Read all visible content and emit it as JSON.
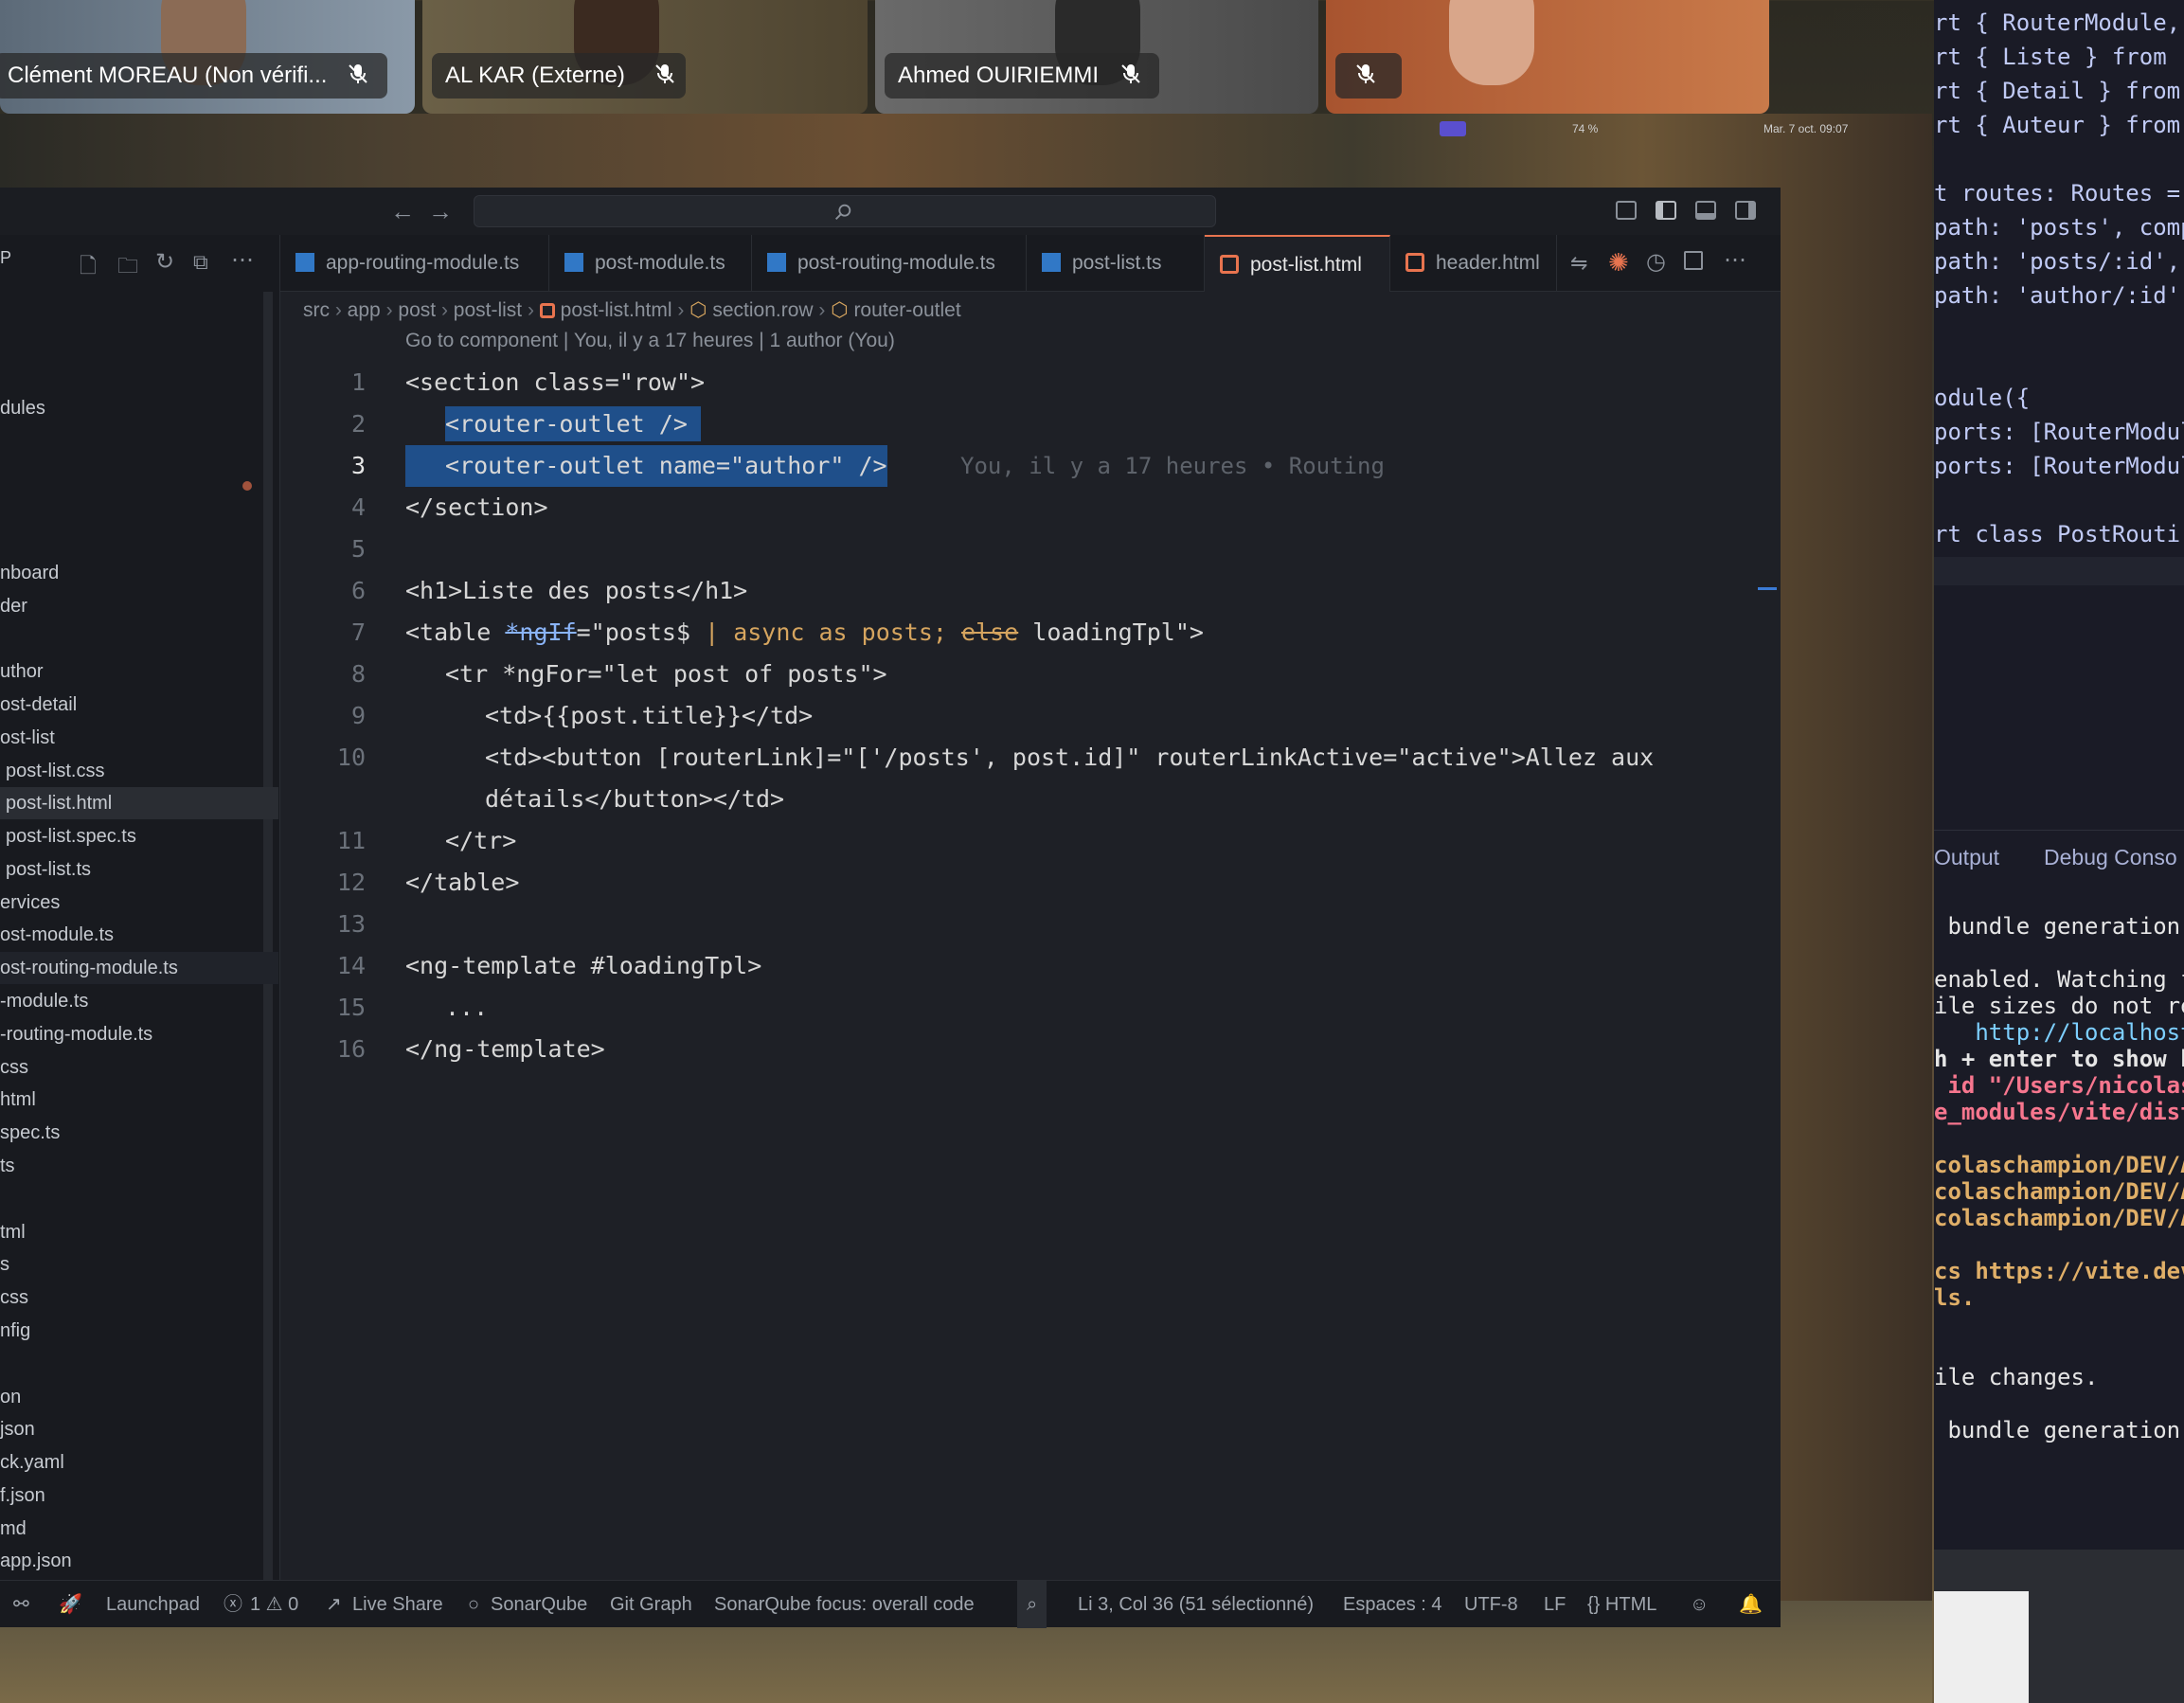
{
  "meeting": {
    "participants": [
      {
        "name": "Clément MOREAU (Non vérifi...",
        "muted": true
      },
      {
        "name": "AL KAR (Externe)",
        "muted": true
      },
      {
        "name": "Ahmed OUIRIEMMI",
        "muted": true
      },
      {
        "name": "",
        "muted": true
      }
    ]
  },
  "menubar": {
    "battery": "74 %",
    "datetime": "Mar. 7 oct. 09:07"
  },
  "sidebar": {
    "header": "P",
    "items": [
      {
        "label": "dules",
        "top": 0
      },
      {
        "label": "nboard"
      },
      {
        "label": "der"
      },
      {
        "label": "uthor"
      },
      {
        "label": "ost-detail"
      },
      {
        "label": "ost-list"
      },
      {
        "label": "post-list.css"
      },
      {
        "label": "post-list.html"
      },
      {
        "label": "post-list.spec.ts"
      },
      {
        "label": "post-list.ts"
      },
      {
        "label": "ervices"
      },
      {
        "label": "ost-module.ts"
      },
      {
        "label": "ost-routing-module.ts"
      },
      {
        "label": "-module.ts"
      },
      {
        "label": "-routing-module.ts"
      },
      {
        "label": "css"
      },
      {
        "label": "html"
      },
      {
        "label": "spec.ts"
      },
      {
        "label": "ts"
      },
      {
        "label": "tml"
      },
      {
        "label": "s"
      },
      {
        "label": "css"
      },
      {
        "label": "nfig"
      },
      {
        "label": "on"
      },
      {
        "label": "json"
      },
      {
        "label": "ck.yaml"
      },
      {
        "label": "f.json"
      },
      {
        "label": "md"
      },
      {
        "label": "app.json"
      }
    ]
  },
  "tabs": [
    {
      "label": "app-routing-module.ts",
      "type": "ts"
    },
    {
      "label": "post-module.ts",
      "type": "ts"
    },
    {
      "label": "post-routing-module.ts",
      "type": "ts"
    },
    {
      "label": "post-list.ts",
      "type": "ts"
    },
    {
      "label": "post-list.html",
      "type": "html",
      "active": true
    },
    {
      "label": "header.html",
      "type": "html"
    }
  ],
  "breadcrumb": {
    "src": "src",
    "app": "app",
    "post": "post",
    "postlist": "post-list",
    "file": "post-list.html",
    "section": "section.row",
    "outlet": "router-outlet"
  },
  "codelens": "Go to component | You, il y a 17 heures | 1 author (You)",
  "blame": "You, il y a 17 heures • Routing",
  "code": {
    "l1": "<section class=\"row\">",
    "l2": "<router-outlet />",
    "l3": "<router-outlet name=\"author\" />",
    "l4": "</section>",
    "l6": "<h1>Liste des posts</h1>",
    "l7a": "<table ",
    "l7b": "*ngIf",
    "l7c": "=\"posts$ ",
    "l7d": "| async as posts; ",
    "l7e": "else",
    "l7f": " loadingTpl\">",
    "l8": "<tr *ngFor=\"let post of posts\">",
    "l9": "<td>{{post.title}}</td>",
    "l10a": "<td><button [routerLink]=\"['/posts', post.id]\" routerLinkActive=\"active\">Allez aux",
    "l10b": "détails</button></td>",
    "l11": "</tr>",
    "l12": "</table>",
    "l14": "<ng-template #loadingTpl>",
    "l15": "...",
    "l16": "</ng-template>"
  },
  "line_numbers": [
    "1",
    "2",
    "3",
    "4",
    "5",
    "6",
    "7",
    "8",
    "9",
    "10",
    "11",
    "12",
    "13",
    "14",
    "15",
    "16"
  ],
  "status": {
    "launchpad": "Launchpad",
    "problems": "1 ⚠ 0",
    "liveshare": "Live Share",
    "sonarqube": "SonarQube",
    "gitgraph": "Git Graph",
    "sonarfocus": "SonarQube focus: overall code",
    "cursor": "Li 3, Col 36 (51 sélectionné)",
    "spaces": "Espaces : 4",
    "encoding": "UTF-8",
    "eol": "LF",
    "language": "{} HTML"
  },
  "right_code": [
    "rt { RouterModule,",
    "rt { Liste } from",
    "rt { Detail } from",
    "rt { Auteur } from",
    "",
    "t routes: Routes =",
    "path: 'posts', comp",
    "path: 'posts/:id',",
    "path: 'author/:id',",
    "",
    "",
    "odule({",
    "ports: [RouterModul",
    "ports: [RouterModul",
    "",
    "rt class PostRouti"
  ],
  "right_panel": {
    "output": "Output",
    "debug": "Debug Conso"
  },
  "terminal": [
    " bundle generation",
    "",
    "enabled. Watching f",
    "ile sizes do not re",
    "   http://localhost",
    "h + enter to show h",
    " id \"/Users/nicolas",
    "e_modules/vite/dist",
    "",
    "colaschampion/DEV/A",
    "colaschampion/DEV/A",
    "colaschampion/DEV/A",
    "",
    "cs https://vite.dev",
    "ls.",
    "",
    "",
    "ile changes.",
    "",
    " bundle generation"
  ]
}
